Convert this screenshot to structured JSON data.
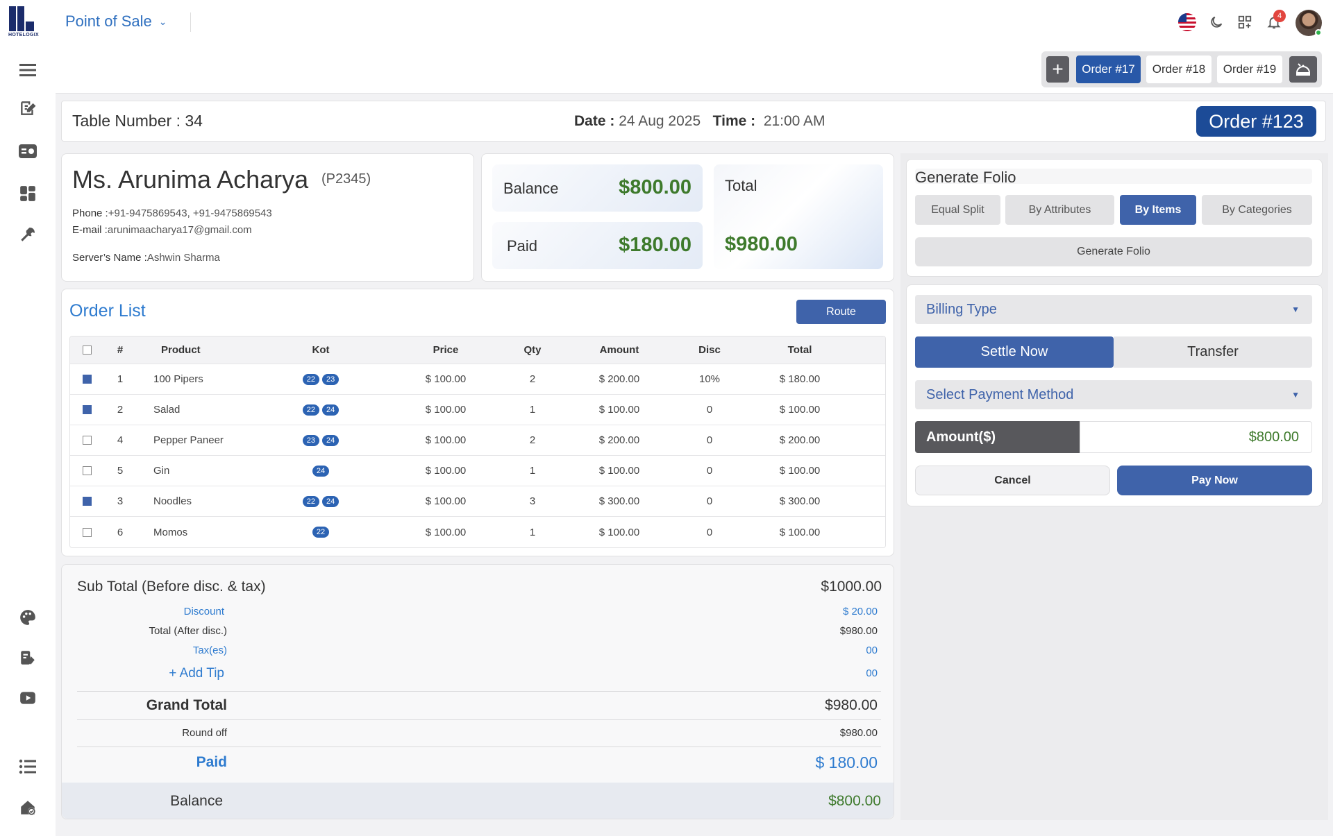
{
  "topbar": {
    "logo_text": "HOTELOGIX",
    "app_title": "Point of Sale",
    "notification_count": "4"
  },
  "order_tabs": {
    "tabs": [
      {
        "label": "Order #17",
        "active": true
      },
      {
        "label": "Order #18",
        "active": false
      },
      {
        "label": "Order #19",
        "active": false
      }
    ]
  },
  "info": {
    "table_label": "Table Number :",
    "table_value": "34",
    "date_label": "Date :",
    "date_value": "24 Aug 2025",
    "time_label": "Time :",
    "time_value": "21:00 AM",
    "order_number": "Order #123"
  },
  "guest": {
    "name": "Ms. Arunima Acharya",
    "id": "(P2345)",
    "phone_label": "Phone :",
    "phone_value": "+91-9475869543, +91-9475869543",
    "email_label": "E-mail :",
    "email_value": "arunimaacharya17@gmail.com",
    "server_label": "Server’s Name :",
    "server_value": "Ashwin Sharma"
  },
  "summary": {
    "balance_label": "Balance",
    "balance_value": "$800.00",
    "paid_label": "Paid",
    "paid_value": "$180.00",
    "total_label": "Total",
    "total_value": "$980.00"
  },
  "order_list": {
    "title": "Order List",
    "route_label": "Route",
    "columns": [
      "#",
      "Product",
      "Kot",
      "Price",
      "Qty",
      "Amount",
      "Disc",
      "Total"
    ],
    "rows": [
      {
        "checked": true,
        "no": "1",
        "product": "100 Pipers",
        "kots": [
          "22",
          "23"
        ],
        "price": "$ 100.00",
        "qty": "2",
        "amount": "$ 200.00",
        "disc": "10%",
        "total": "$ 180.00"
      },
      {
        "checked": true,
        "no": "2",
        "product": "Salad",
        "kots": [
          "22",
          "24"
        ],
        "price": "$ 100.00",
        "qty": "1",
        "amount": "$ 100.00",
        "disc": "0",
        "total": "$ 100.00"
      },
      {
        "checked": false,
        "no": "4",
        "product": "Pepper Paneer",
        "kots": [
          "23",
          "24"
        ],
        "price": "$ 100.00",
        "qty": "2",
        "amount": "$ 200.00",
        "disc": "0",
        "total": "$ 200.00"
      },
      {
        "checked": false,
        "no": "5",
        "product": "Gin",
        "kots": [
          "24"
        ],
        "price": "$ 100.00",
        "qty": "1",
        "amount": "$ 100.00",
        "disc": "0",
        "total": "$ 100.00"
      },
      {
        "checked": true,
        "no": "3",
        "product": "Noodles",
        "kots": [
          "22",
          "24"
        ],
        "price": "$ 100.00",
        "qty": "3",
        "amount": "$ 300.00",
        "disc": "0",
        "total": "$ 300.00"
      },
      {
        "checked": false,
        "no": "6",
        "product": "Momos",
        "kots": [
          "22"
        ],
        "price": "$ 100.00",
        "qty": "1",
        "amount": "$ 100.00",
        "disc": "0",
        "total": "$ 100.00"
      }
    ]
  },
  "totals": {
    "subtotal_label": "Sub Total (Before disc. & tax)",
    "subtotal_value": "$1000.00",
    "discount_label": "Discount",
    "discount_value": "$ 20.00",
    "after_disc_label": "Total (After disc.)",
    "after_disc_value": "$980.00",
    "tax_label": "Tax(es)",
    "tax_value": "00",
    "tip_label": "+ Add Tip",
    "tip_value": "00",
    "grand_total_label": "Grand Total",
    "grand_total_value": "$980.00",
    "round_off_label": "Round off",
    "round_off_value": "$980.00",
    "paid_label": "Paid",
    "paid_value": "$ 180.00",
    "balance_label": "Balance",
    "balance_value": "$800.00"
  },
  "folio": {
    "title": "Generate Folio",
    "split_options": [
      {
        "label": "Equal Split",
        "active": false
      },
      {
        "label": "By Attributes",
        "active": false
      },
      {
        "label": "By Items",
        "active": true
      },
      {
        "label": "By Categories",
        "active": false
      }
    ],
    "generate_label": "Generate Folio"
  },
  "payment": {
    "billing_type_label": "Billing Type",
    "settle_label": "Settle Now",
    "transfer_label": "Transfer",
    "payment_method_label": "Select Payment Method",
    "amount_label": "Amount($)",
    "amount_value": "$800.00",
    "cancel_label": "Cancel",
    "pay_label": "Pay Now"
  },
  "colors": {
    "primary": "#3f63aa",
    "dark_primary": "#1c4b97",
    "link_blue": "#2e7bcf",
    "money_green": "#3e7a2c"
  }
}
